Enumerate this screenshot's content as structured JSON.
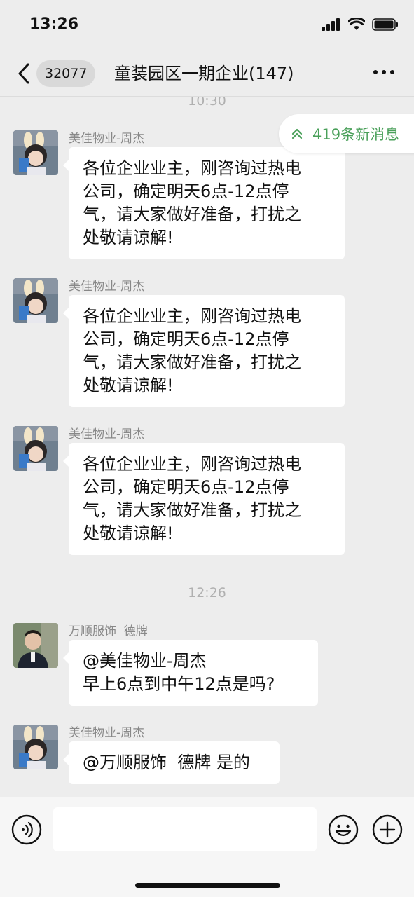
{
  "status_bar": {
    "time": "13:26"
  },
  "nav": {
    "unread_badge": "32077",
    "title": "童装园区一期企业(147)"
  },
  "new_messages_pill": "419条新消息",
  "timestamps": [
    "10:30",
    "12:26"
  ],
  "messages": [
    {
      "sender": "美佳物业-周杰",
      "text": "各位企业业主，刚咨询过热电\n公司，确定明天6点-12点停\n气，请大家做好准备，打扰之\n处敬请谅解!"
    },
    {
      "sender": "美佳物业-周杰",
      "text": "各位企业业主，刚咨询过热电\n公司，确定明天6点-12点停\n气，请大家做好准备，打扰之\n处敬请谅解!"
    },
    {
      "sender": "美佳物业-周杰",
      "text": "各位企业业主，刚咨询过热电\n公司，确定明天6点-12点停\n气，请大家做好准备，打扰之\n处敬请谅解!"
    },
    {
      "sender": "万顺服饰  德牌",
      "text": "@美佳物业-周杰\n早上6点到中午12点是吗?"
    },
    {
      "sender": "美佳物业-周杰",
      "text": "@万顺服饰  德牌 是的"
    }
  ],
  "colors": {
    "background": "#ededed",
    "bubble": "#ffffff",
    "accent_green": "#4aa05a"
  }
}
